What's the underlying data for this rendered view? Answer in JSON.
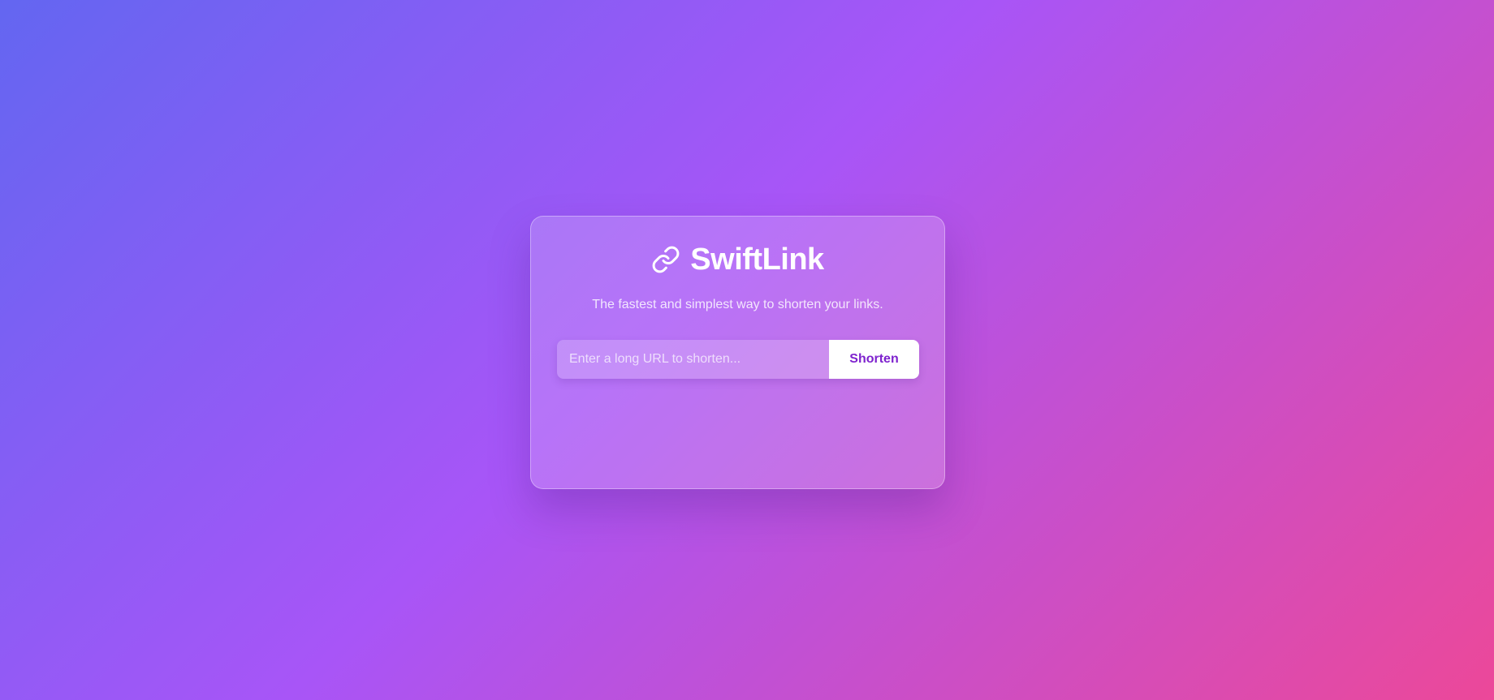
{
  "app": {
    "name": "SwiftLink",
    "tagline": "The fastest and simplest way to shorten your links.",
    "logo_icon": "link-icon"
  },
  "form": {
    "url_placeholder": "Enter a long URL to shorten...",
    "url_value": "",
    "submit_label": "Shorten"
  },
  "colors": {
    "gradient_start": "#6366f1",
    "gradient_mid": "#a855f7",
    "gradient_end": "#ec4899",
    "button_text": "#7e22ce"
  }
}
